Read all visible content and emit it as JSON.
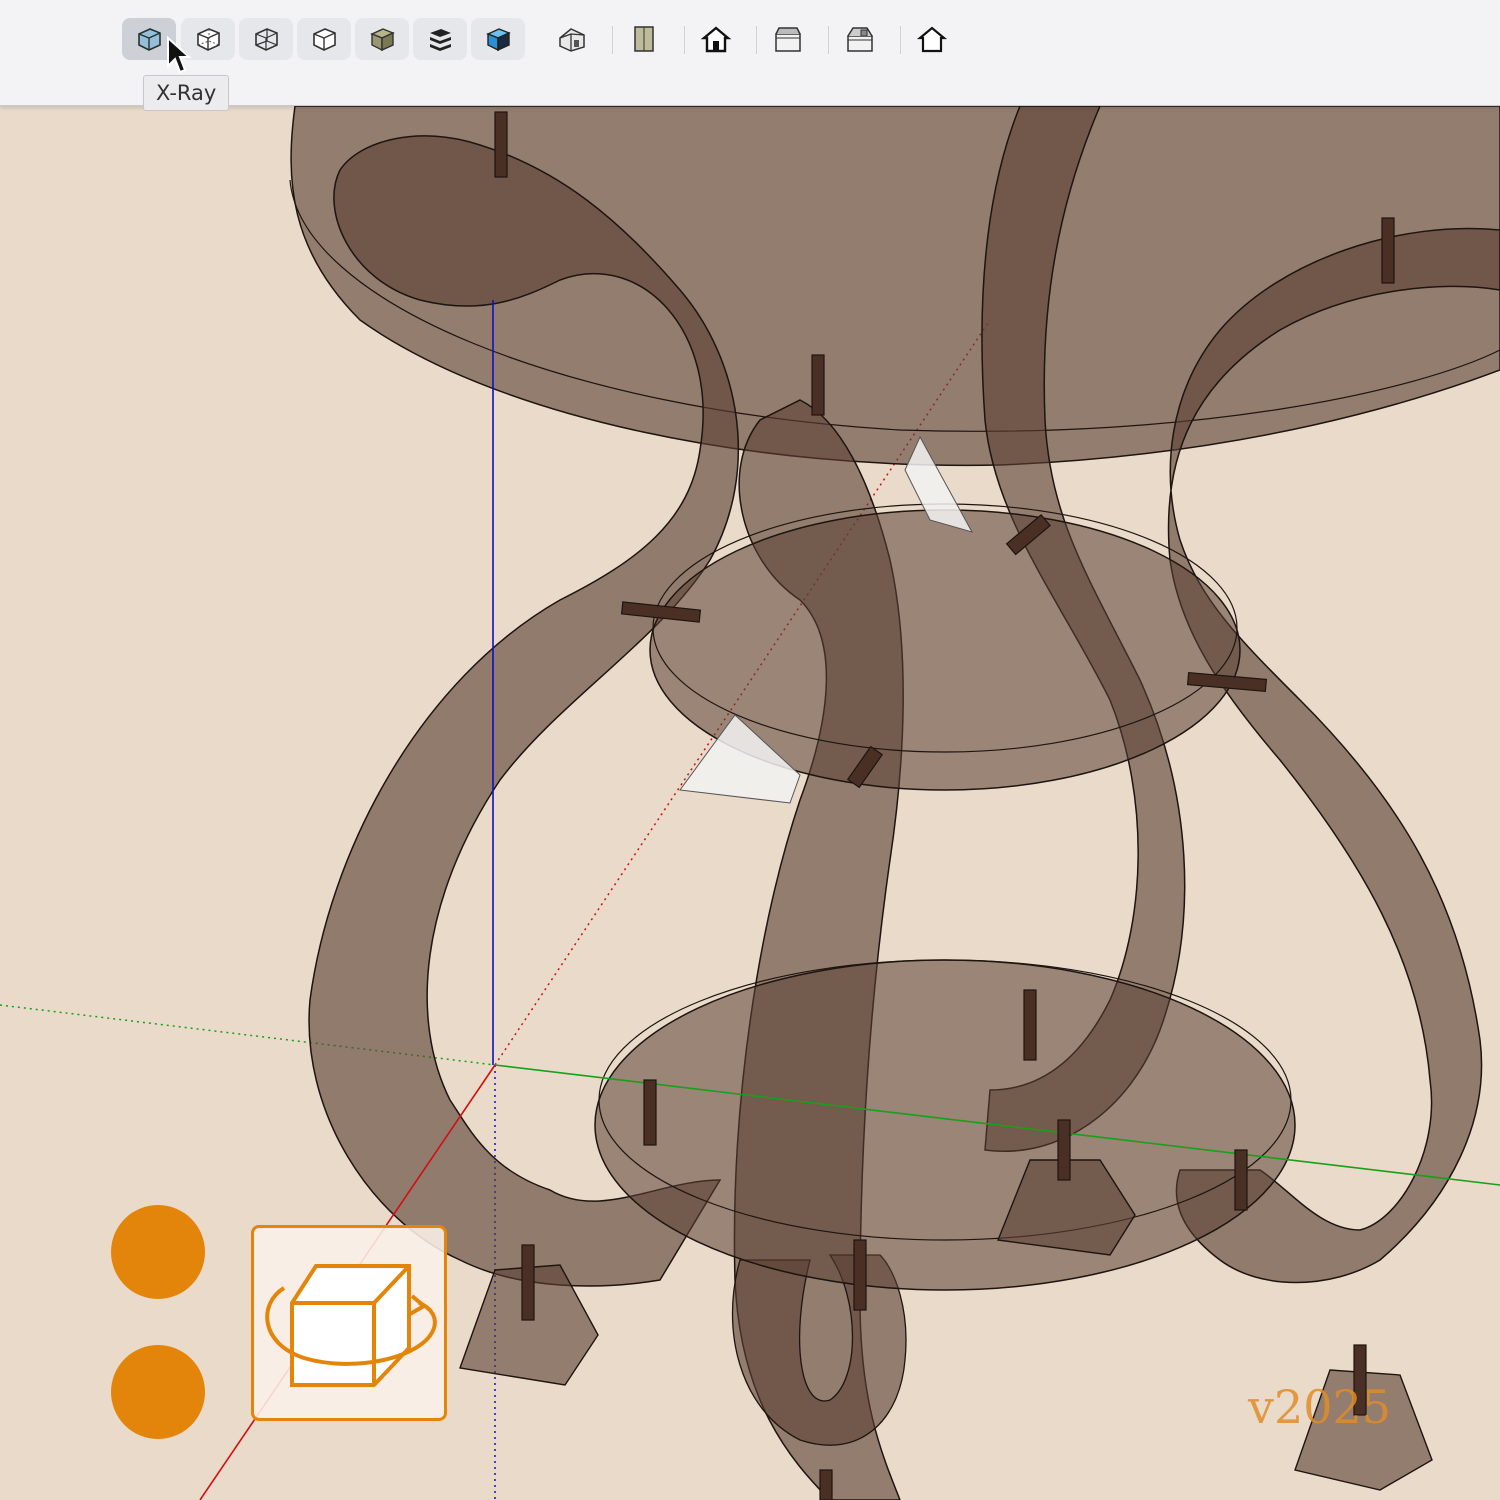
{
  "toolbar": {
    "tooltip": "X-Ray",
    "face_style_buttons": [
      {
        "name": "xray-button",
        "icon": "xray-icon",
        "active": true
      },
      {
        "name": "back-edges-button",
        "icon": "back-edges-icon"
      },
      {
        "name": "wireframe-button",
        "icon": "wireframe-icon"
      },
      {
        "name": "hidden-line-button",
        "icon": "hidden-line-icon"
      },
      {
        "name": "shaded-button",
        "icon": "shaded-icon"
      },
      {
        "name": "shaded-with-textures-button",
        "icon": "shaded-textures-icon"
      },
      {
        "name": "monochrome-button",
        "icon": "monochrome-icon"
      }
    ],
    "view_buttons": [
      {
        "name": "iso-view-button",
        "icon": "iso-house-icon"
      },
      {
        "name": "top-view-button",
        "icon": "top-view-icon"
      },
      {
        "name": "front-view-button",
        "icon": "front-house-icon"
      },
      {
        "name": "right-view-button",
        "icon": "right-house-icon"
      },
      {
        "name": "back-view-button",
        "icon": "back-house-icon"
      },
      {
        "name": "left-view-button",
        "icon": "left-house-icon"
      }
    ]
  },
  "overlay": {
    "orbit_icon": "orbit-cube-icon",
    "version_label": "v2025",
    "accent_color": "#e4850b"
  },
  "colors": {
    "background": "#e9dac9",
    "wood": "#5a4033",
    "axis_red": "#d01010",
    "axis_green": "#18a018",
    "axis_blue": "#1010c0"
  }
}
